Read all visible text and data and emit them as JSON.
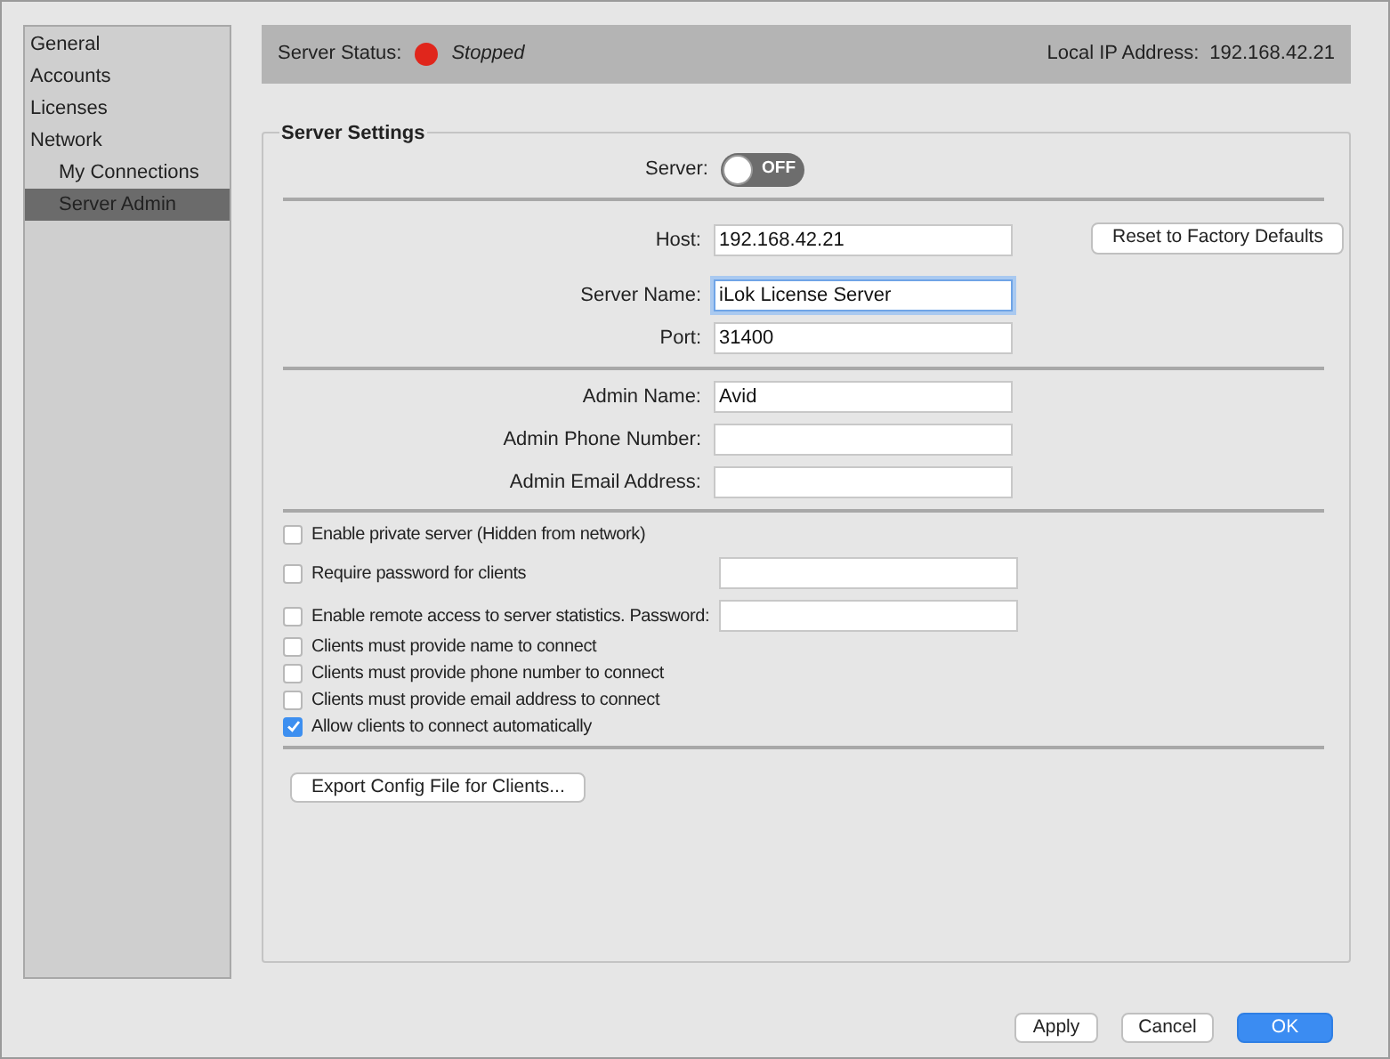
{
  "sidebar": {
    "items": [
      {
        "label": "General",
        "selected": false
      },
      {
        "label": "Accounts",
        "selected": false
      },
      {
        "label": "Licenses",
        "selected": false
      },
      {
        "label": "Network",
        "selected": false,
        "children": [
          {
            "label": "My Connections",
            "selected": false
          },
          {
            "label": "Server Admin",
            "selected": true
          }
        ]
      }
    ]
  },
  "status_bar": {
    "label": "Server Status:",
    "running": false,
    "status": "Stopped",
    "ip_label": "Local IP Address:",
    "ip": "192.168.42.21"
  },
  "group": {
    "title": "Server Settings",
    "server_toggle": {
      "label": "Server:",
      "on": false,
      "text": "OFF"
    },
    "network_fields": [
      {
        "label": "Host:",
        "value": "192.168.42.21",
        "focused": false
      },
      {
        "label": "Server Name:",
        "value": "iLok License Server",
        "focused": true
      },
      {
        "label": "Port:",
        "value": "31400",
        "focused": false
      }
    ],
    "reset_button": "Reset to Factory Defaults",
    "admin_fields": [
      {
        "label": "Admin Name:",
        "value": "Avid",
        "focused": false
      },
      {
        "label": "Admin Phone Number:",
        "focused": false
      },
      {
        "label": "Admin Email Address:",
        "focused": false
      }
    ],
    "options": [
      {
        "kind": "checkbox",
        "label": "Enable private server (Hidden from network)",
        "checked": false
      },
      {
        "kind": "checkbox-field",
        "label": "Require password for clients",
        "checked": false
      },
      {
        "kind": "checkbox-field",
        "label": "Enable remote access to server statistics. Password:",
        "checked": false
      },
      {
        "kind": "compact",
        "label": "Clients must provide name to connect",
        "checked": false
      },
      {
        "kind": "compact",
        "label": "Clients must provide phone number to connect",
        "checked": false
      },
      {
        "kind": "compact",
        "label": "Clients must provide email address to connect",
        "checked": false
      },
      {
        "kind": "compact",
        "label": "Allow clients to connect automatically",
        "checked": true
      }
    ],
    "export_button": "Export Config File for Clients..."
  },
  "buttons": [
    {
      "label": "Apply",
      "default": false
    },
    {
      "label": "Cancel",
      "default": false
    },
    {
      "label": "OK",
      "default": true
    }
  ]
}
